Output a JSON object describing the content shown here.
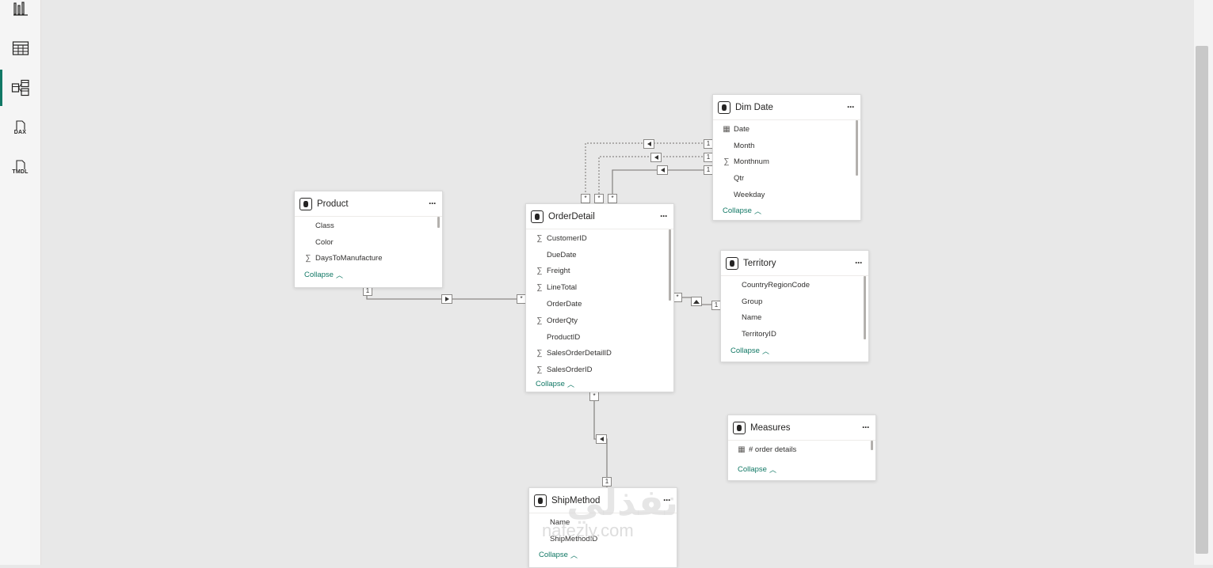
{
  "nav": {
    "report_icon": "bar-chart-icon",
    "table_icon": "table-grid-icon",
    "model_icon": "model-diagram-icon",
    "dax_label": "DAX",
    "tmdl_label": "TMDL"
  },
  "tables": {
    "dim_date": {
      "title": "Dim Date",
      "fields": [
        {
          "name": "Date",
          "icon": "calendar-icon"
        },
        {
          "name": "Month",
          "icon": ""
        },
        {
          "name": "Monthnum",
          "icon": "sigma-icon"
        },
        {
          "name": "Qtr",
          "icon": ""
        },
        {
          "name": "Weekday",
          "icon": ""
        }
      ],
      "collapse": "Collapse"
    },
    "product": {
      "title": "Product",
      "fields": [
        {
          "name": "Class",
          "icon": ""
        },
        {
          "name": "Color",
          "icon": ""
        },
        {
          "name": "DaysToManufacture",
          "icon": "sigma-icon"
        }
      ],
      "collapse": "Collapse"
    },
    "order_detail": {
      "title": "OrderDetail",
      "fields": [
        {
          "name": "CustomerID",
          "icon": "sigma-icon"
        },
        {
          "name": "DueDate",
          "icon": ""
        },
        {
          "name": "Freight",
          "icon": "sigma-icon"
        },
        {
          "name": "LineTotal",
          "icon": "sigma-icon"
        },
        {
          "name": "OrderDate",
          "icon": ""
        },
        {
          "name": "OrderQty",
          "icon": "sigma-icon"
        },
        {
          "name": "ProductID",
          "icon": ""
        },
        {
          "name": "SalesOrderDetailID",
          "icon": "sigma-icon"
        },
        {
          "name": "SalesOrderID",
          "icon": "sigma-icon"
        }
      ],
      "collapse": "Collapse"
    },
    "territory": {
      "title": "Territory",
      "fields": [
        {
          "name": "CountryRegionCode",
          "icon": ""
        },
        {
          "name": "Group",
          "icon": ""
        },
        {
          "name": "Name",
          "icon": ""
        },
        {
          "name": "TerritoryID",
          "icon": ""
        }
      ],
      "collapse": "Collapse"
    },
    "measures": {
      "title": "Measures",
      "fields": [
        {
          "name": "# order details",
          "icon": "calculator-icon"
        }
      ],
      "collapse": "Collapse"
    },
    "ship_method": {
      "title": "ShipMethod",
      "fields": [
        {
          "name": "Name",
          "icon": ""
        },
        {
          "name": "ShipMethodID",
          "icon": ""
        }
      ],
      "collapse": "Collapse"
    }
  },
  "relationships": {
    "one": "1",
    "many": "*"
  },
  "watermark": {
    "logo": "نفذلي",
    "url": "nafezly.com"
  },
  "colors": {
    "accent": "#117865",
    "canvas": "#e8e8e8",
    "line": "#8a8886"
  },
  "more_glyph": "···",
  "chevron_up": "^"
}
